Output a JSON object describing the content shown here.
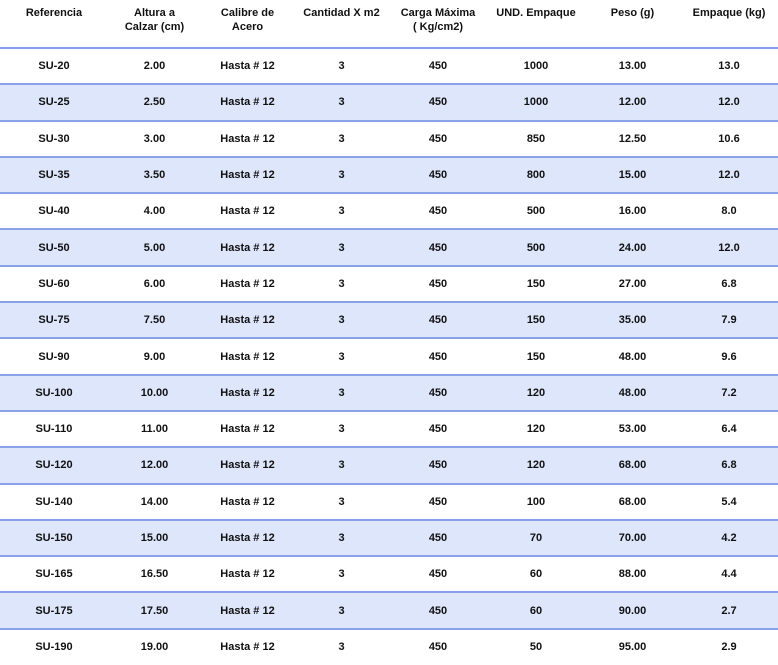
{
  "table": {
    "headers": [
      "Referencia",
      "Altura a\nCalzar (cm)",
      "Calibre de\nAcero",
      "Cantidad X m2",
      "Carga Máxima\n( Kg/cm2)",
      "UND. Empaque",
      "Peso (g)",
      "Empaque (kg)"
    ],
    "rows": [
      [
        "SU-20",
        "2.00",
        "Hasta  # 12",
        "3",
        "450",
        "1000",
        "13.00",
        "13.0"
      ],
      [
        "SU-25",
        "2.50",
        "Hasta  # 12",
        "3",
        "450",
        "1000",
        "12.00",
        "12.0"
      ],
      [
        "SU-30",
        "3.00",
        "Hasta  # 12",
        "3",
        "450",
        "850",
        "12.50",
        "10.6"
      ],
      [
        "SU-35",
        "3.50",
        "Hasta  # 12",
        "3",
        "450",
        "800",
        "15.00",
        "12.0"
      ],
      [
        "SU-40",
        "4.00",
        "Hasta  # 12",
        "3",
        "450",
        "500",
        "16.00",
        "8.0"
      ],
      [
        "SU-50",
        "5.00",
        "Hasta  # 12",
        "3",
        "450",
        "500",
        "24.00",
        "12.0"
      ],
      [
        "SU-60",
        "6.00",
        "Hasta  # 12",
        "3",
        "450",
        "150",
        "27.00",
        "6.8"
      ],
      [
        "SU-75",
        "7.50",
        "Hasta  # 12",
        "3",
        "450",
        "150",
        "35.00",
        "7.9"
      ],
      [
        "SU-90",
        "9.00",
        "Hasta  # 12",
        "3",
        "450",
        "150",
        "48.00",
        "9.6"
      ],
      [
        "SU-100",
        "10.00",
        "Hasta  # 12",
        "3",
        "450",
        "120",
        "48.00",
        "7.2"
      ],
      [
        "SU-110",
        "11.00",
        "Hasta  # 12",
        "3",
        "450",
        "120",
        "53.00",
        "6.4"
      ],
      [
        "SU-120",
        "12.00",
        "Hasta  # 12",
        "3",
        "450",
        "120",
        "68.00",
        "6.8"
      ],
      [
        "SU-140",
        "14.00",
        "Hasta  # 12",
        "3",
        "450",
        "100",
        "68.00",
        "5.4"
      ],
      [
        "SU-150",
        "15.00",
        "Hasta  # 12",
        "3",
        "450",
        "70",
        "70.00",
        "4.2"
      ],
      [
        "SU-165",
        "16.50",
        "Hasta  # 12",
        "3",
        "450",
        "60",
        "88.00",
        "4.4"
      ],
      [
        "SU-175",
        "17.50",
        "Hasta  # 12",
        "3",
        "450",
        "60",
        "90.00",
        "2.7"
      ],
      [
        "SU-190",
        "19.00",
        "Hasta  # 12",
        "3",
        "450",
        "50",
        "95.00",
        "2.9"
      ]
    ]
  },
  "colors": {
    "row_stripe": "#dde6fb",
    "row_separator": "#8aa3e8",
    "text": "#111111"
  }
}
